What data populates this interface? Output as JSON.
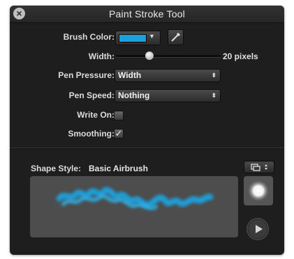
{
  "window": {
    "title": "Paint Stroke Tool"
  },
  "brush_color": {
    "label": "Brush Color:",
    "color": "#1ea0dc"
  },
  "width": {
    "label": "Width:",
    "value_text": "20 pixels",
    "level": 0.2
  },
  "pen_pressure": {
    "label": "Pen Pressure:",
    "selected": "Width"
  },
  "pen_speed": {
    "label": "Pen Speed:",
    "selected": "Nothing"
  },
  "write_on": {
    "label": "Write On:",
    "checked": false
  },
  "smoothing": {
    "label": "Smoothing:",
    "checked": true
  },
  "shape_style": {
    "label": "Shape Style:",
    "value": "Basic Airbrush"
  },
  "icons": [
    "close-icon",
    "dropdown-arrow-icon",
    "eyedropper-icon",
    "updown-arrows-icon",
    "shape-menu-icon",
    "checkmark-icon",
    "airbrush-dot-icon",
    "play-icon"
  ]
}
